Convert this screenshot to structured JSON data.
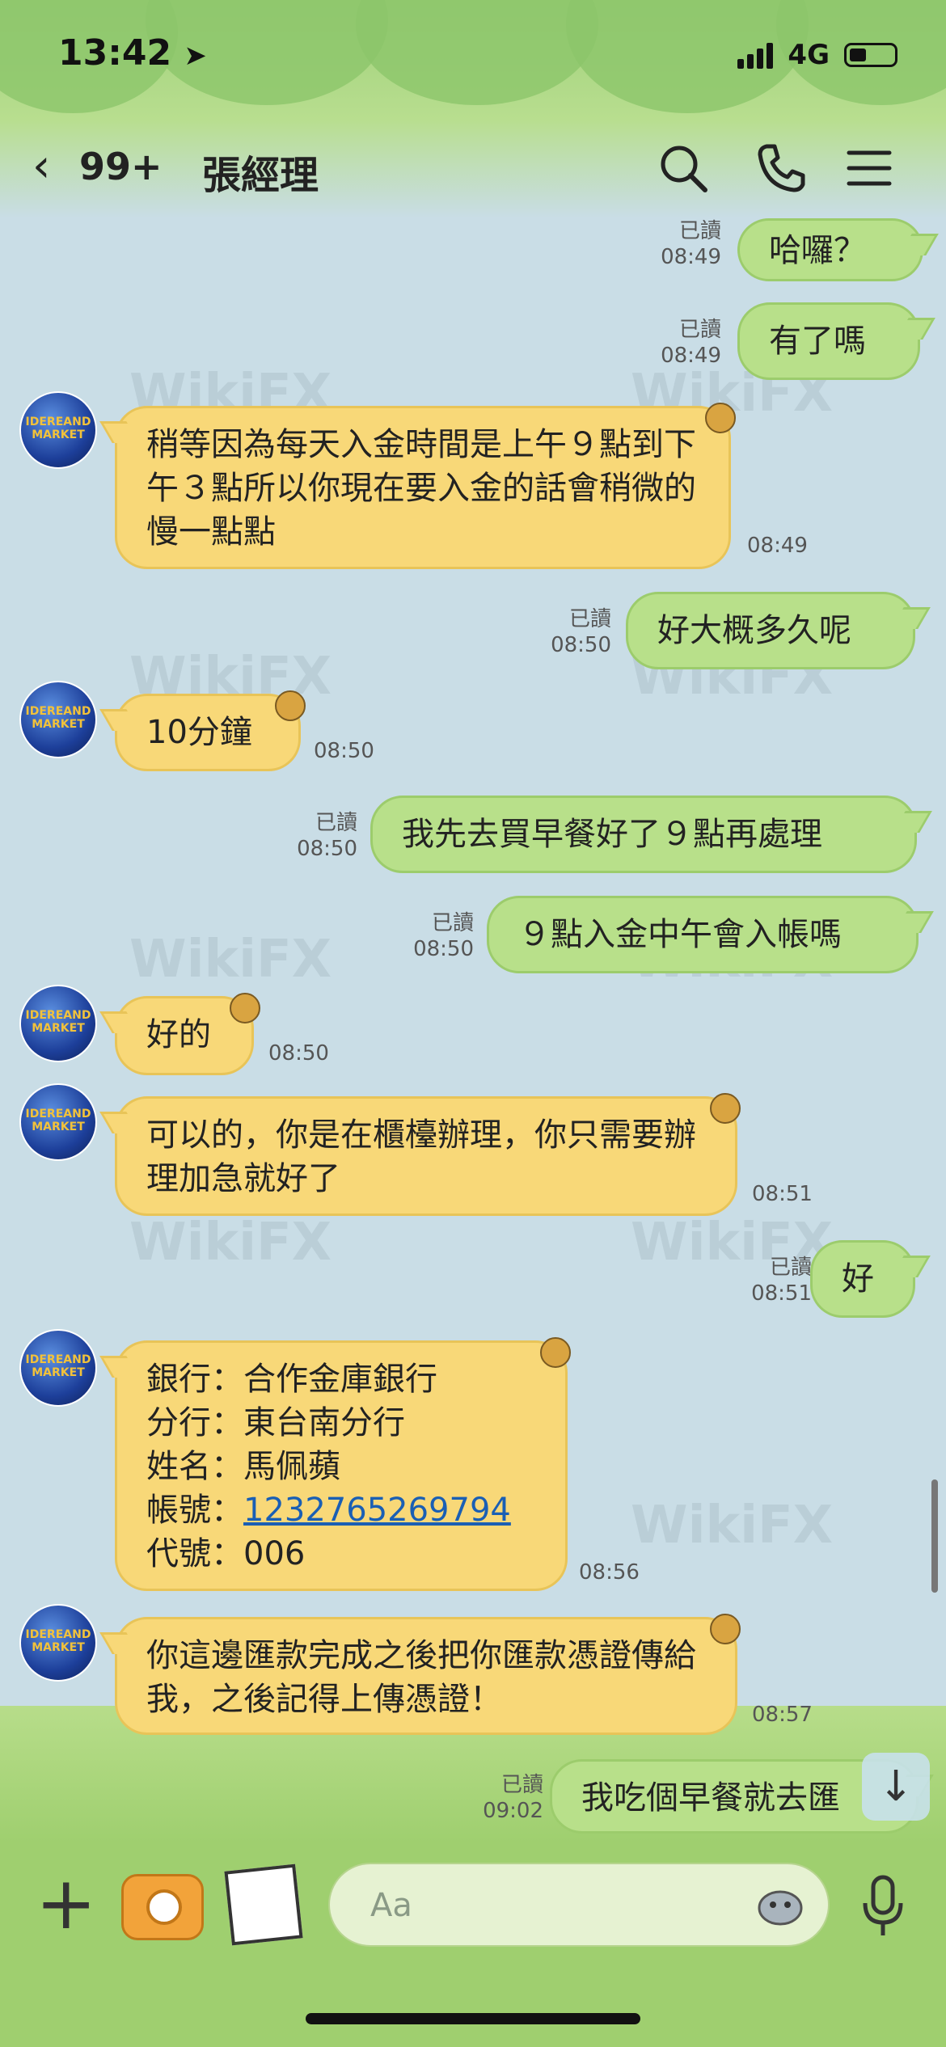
{
  "status_bar": {
    "time": "13:42",
    "network": "4G"
  },
  "header": {
    "back_symbol": "‹",
    "unread_count": "99+",
    "title": "張經理"
  },
  "read_label": "已讀",
  "messages": [
    {
      "side": "out",
      "text": "哈囉？",
      "time": "08:49"
    },
    {
      "side": "out",
      "text": "有了嗎",
      "time": "08:49"
    },
    {
      "side": "in",
      "text": "稍等因為每天入金時間是上午９點到下午３點所以你現在要入金的話會稍微的慢一點點",
      "time": "08:49"
    },
    {
      "side": "out",
      "text": "好大概多久呢",
      "time": "08:50"
    },
    {
      "side": "in",
      "text": "10分鐘",
      "time": "08:50"
    },
    {
      "side": "out",
      "text": "我先去買早餐好了９點再處理",
      "time": "08:50"
    },
    {
      "side": "out",
      "text": "９點入金中午會入帳嗎",
      "time": "08:50"
    },
    {
      "side": "in",
      "text": "好的",
      "time": "08:50"
    },
    {
      "side": "in",
      "text": "可以的，你是在櫃檯辦理，你只需要辦理加急就好了",
      "time": "08:51"
    },
    {
      "side": "out",
      "text": "好",
      "time": "08:51"
    },
    {
      "side": "in",
      "lines": [
        "銀行：合作金庫銀行",
        "分行：東台南分行",
        "姓名：馬佩蘋",
        "代號：006"
      ],
      "account_label": "帳號：",
      "account_number": "1232765269794",
      "time": "08:56"
    },
    {
      "side": "in",
      "text": "你這邊匯款完成之後把你匯款憑證傳給我，之後記得上傳憑證！",
      "time": "08:57"
    },
    {
      "side": "out",
      "text": "我吃個早餐就去匯",
      "time": "09:02"
    }
  ],
  "avatar_text": "IDEREAND MARKET",
  "watermark": "WikiFX",
  "input": {
    "placeholder": "Aa"
  },
  "icons": [
    "location-arrow-icon",
    "signal-icon",
    "battery-icon",
    "back-chevron-icon",
    "search-icon",
    "phone-icon",
    "menu-icon",
    "plus-icon",
    "camera-icon",
    "photo-icon",
    "sticker-icon",
    "mic-icon",
    "arrow-down-icon"
  ],
  "colors": {
    "incoming_bubble": "#f8d878",
    "outgoing_bubble": "#b8e08a",
    "link": "#1a5fb4"
  }
}
